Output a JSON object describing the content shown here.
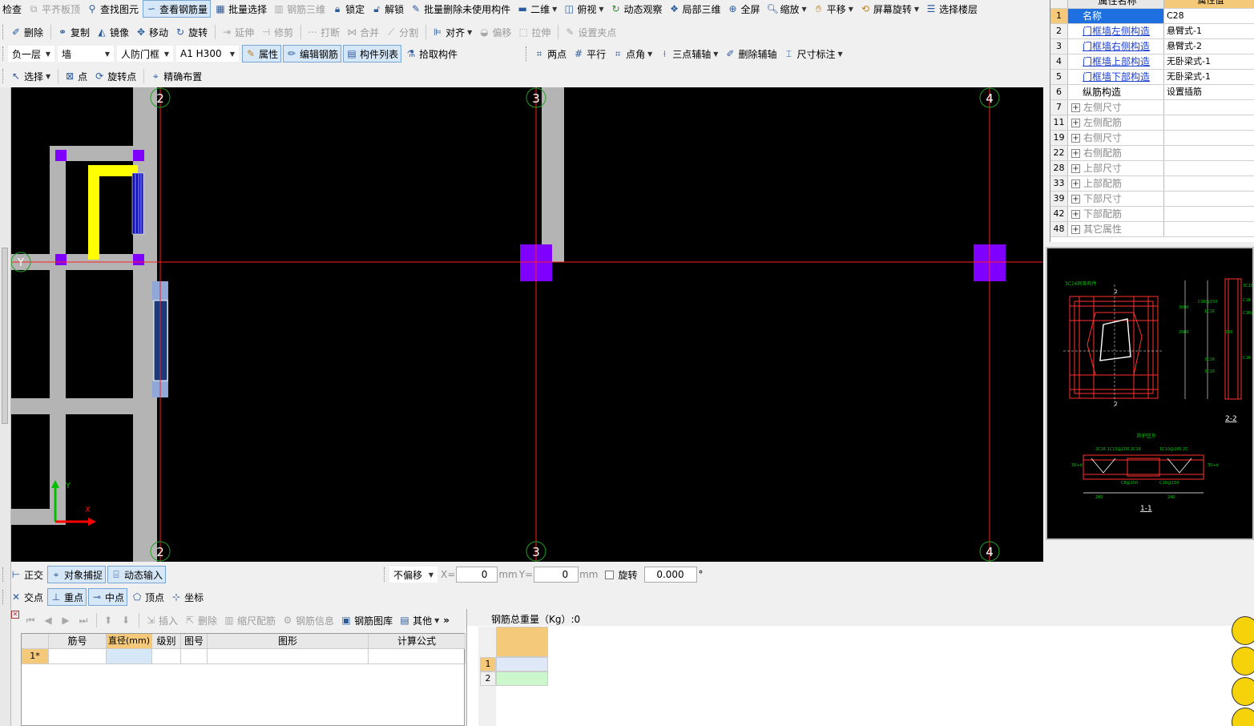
{
  "toolbar1": {
    "items": [
      "检查",
      "平齐板顶",
      "查找图元",
      "查看钢筋量",
      "批量选择",
      "钢筋三维",
      "锁定",
      "解锁",
      "批量删除未使用构件",
      "二维",
      "俯视",
      "动态观察",
      "局部三维",
      "全屏",
      "缩放",
      "平移",
      "屏幕旋转",
      "选择楼层"
    ]
  },
  "toolbar2": {
    "items": [
      "删除",
      "复制",
      "镜像",
      "移动",
      "旋转",
      "延伸",
      "修剪",
      "打断",
      "合并",
      "分割",
      "对齐",
      "偏移",
      "拉伸",
      "设置夹点"
    ]
  },
  "toolbar3": {
    "floor": "负一层",
    "type": "墙",
    "component": "人防门框",
    "spec": "A1 H300",
    "items": [
      "属性",
      "编辑钢筋",
      "构件列表",
      "拾取构件"
    ],
    "draw": [
      "两点",
      "平行",
      "点角",
      "三点辅轴",
      "删除辅轴",
      "尺寸标注"
    ]
  },
  "toolbar4": {
    "items": [
      "选择",
      "点",
      "旋转点",
      "精确布置"
    ]
  },
  "canvas": {
    "axis_labels": [
      "2",
      "3",
      "4",
      "2",
      "3",
      "4",
      "Y"
    ]
  },
  "props": {
    "header_name": "属性名称",
    "header_value": "属性值",
    "rows": [
      {
        "n": "1",
        "name": "名称",
        "value": "C28",
        "style": "sel"
      },
      {
        "n": "2",
        "name": "门框墙左侧构造",
        "value": "悬臂式-1",
        "style": "blue"
      },
      {
        "n": "3",
        "name": "门框墙右侧构造",
        "value": "悬臂式-2",
        "style": "blue"
      },
      {
        "n": "4",
        "name": "门框墙上部构造",
        "value": "无卧梁式-1",
        "style": "blue"
      },
      {
        "n": "5",
        "name": "门框墙下部构造",
        "value": "无卧梁式-1",
        "style": "blue"
      },
      {
        "n": "6",
        "name": "纵筋构造",
        "value": "设置插筋",
        "style": "plain"
      },
      {
        "n": "7",
        "name": "左侧尺寸",
        "value": "",
        "style": "group"
      },
      {
        "n": "11",
        "name": "左侧配筋",
        "value": "",
        "style": "group"
      },
      {
        "n": "19",
        "name": "右侧尺寸",
        "value": "",
        "style": "group"
      },
      {
        "n": "22",
        "name": "右侧配筋",
        "value": "",
        "style": "group"
      },
      {
        "n": "28",
        "name": "上部尺寸",
        "value": "",
        "style": "group"
      },
      {
        "n": "33",
        "name": "上部配筋",
        "value": "",
        "style": "group"
      },
      {
        "n": "39",
        "name": "下部尺寸",
        "value": "",
        "style": "group"
      },
      {
        "n": "42",
        "name": "下部配筋",
        "value": "",
        "style": "group"
      },
      {
        "n": "48",
        "name": "其它属性",
        "value": "",
        "style": "group"
      }
    ]
  },
  "preview": {
    "labels": [
      "2-2",
      "1-1",
      "防护区外"
    ]
  },
  "snap1": {
    "items": [
      "正交",
      "对象捕捉",
      "动态输入"
    ],
    "offset": "不偏移",
    "x_label": "X=",
    "x_value": "0",
    "unit": "mm",
    "y_label": "Y=",
    "y_value": "0",
    "rotate": "旋转",
    "rotate_value": "0.000",
    "deg": "°"
  },
  "snap2": {
    "items": [
      "交点",
      "重点",
      "中点",
      "顶点",
      "坐标"
    ]
  },
  "rebar_tb": {
    "items": [
      "插入",
      "删除",
      "缩尺配筋",
      "钢筋信息",
      "钢筋图库",
      "其他"
    ],
    "more": "»"
  },
  "rebar_grid": {
    "headers": [
      "筋号",
      "直径(mm)",
      "级别",
      "图号",
      "图形",
      "计算公式"
    ],
    "row": "1*"
  },
  "weight": {
    "label": "钢筋总重量（Kg）:0",
    "rows": [
      "1",
      "2"
    ]
  },
  "colors": {
    "canvas": "#000000",
    "column": "#8000ff",
    "wall": "#b4b4b4",
    "axis": "#ff2020",
    "yellow": "#ffff00"
  }
}
